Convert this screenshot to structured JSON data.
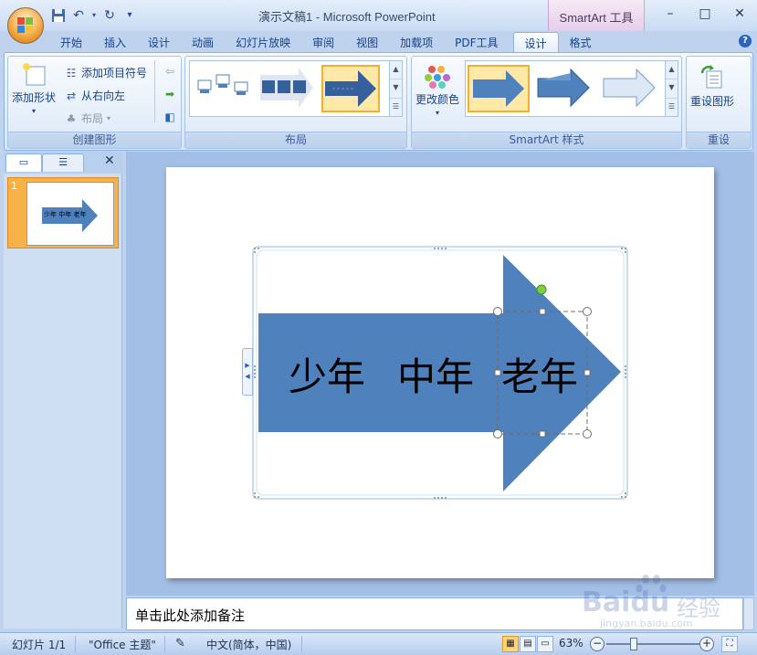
{
  "window": {
    "title": "演示文稿1 - Microsoft PowerPoint",
    "context_tools": "SmartArt 工具",
    "minimize": "–",
    "maximize": "□",
    "close": "✕"
  },
  "quick_access": {
    "save_icon": "save-icon",
    "undo_icon": "undo-icon",
    "redo_icon": "redo-icon",
    "customize_icon": "customize-qat-icon"
  },
  "tabs": [
    "开始",
    "插入",
    "设计",
    "动画",
    "幻灯片放映",
    "审阅",
    "视图",
    "加载项",
    "PDF工具",
    "设计",
    "格式"
  ],
  "active_tab_index": 9,
  "help": "?",
  "ribbon": {
    "create_graphic": {
      "label": "创建图形",
      "add_shape": "添加形状",
      "add_bullet": "添加项目符号",
      "right_to_left": "从右向左",
      "layout": "布局"
    },
    "layouts": {
      "label": "布局"
    },
    "styles": {
      "label": "SmartArt 样式",
      "change_colors": "更改颜色"
    },
    "reset": {
      "label": "重设",
      "reset_graphic": "重设图形"
    }
  },
  "left_pane": {
    "slide_number": "1",
    "thumb_text": "少年 中年 老年"
  },
  "slide": {
    "smartart_items": [
      "少年",
      "中年",
      "老年"
    ],
    "arrow_color": "#4f81bd"
  },
  "notes": {
    "placeholder": "单击此处添加备注"
  },
  "status": {
    "slide_info": "幻灯片 1/1",
    "theme": "\"Office 主题\"",
    "language": "中文(简体，中国)",
    "zoom": "63%",
    "zoom_fraction": 0.63
  },
  "watermark": {
    "brand": "Baidu",
    "suffix": "经验",
    "url": "jingyan.baidu.com"
  }
}
